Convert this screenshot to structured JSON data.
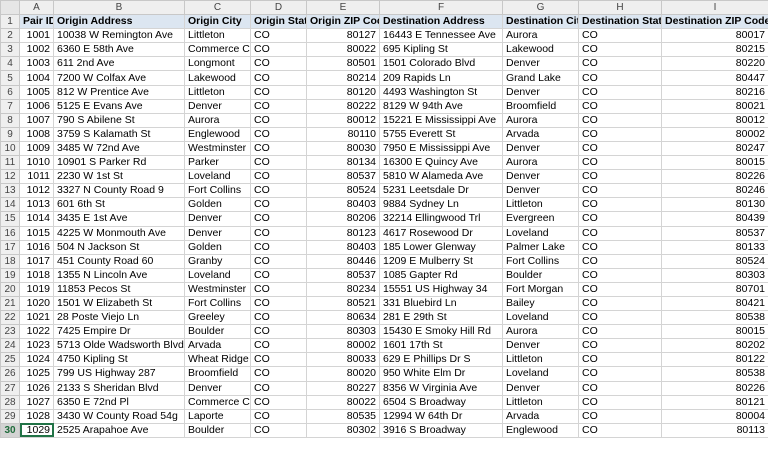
{
  "column_letters": [
    "A",
    "B",
    "C",
    "D",
    "E",
    "F",
    "G",
    "H",
    "I"
  ],
  "headers": [
    "Pair ID",
    "Origin Address",
    "Origin City",
    "Origin State",
    "Origin ZIP Code",
    "Destination Address",
    "Destination City",
    "Destination State",
    "Destination ZIP Code"
  ],
  "rows": [
    [
      "1001",
      "10038 W Remington Ave",
      "Littleton",
      "CO",
      "80127",
      "16443 E Tennessee Ave",
      "Aurora",
      "CO",
      "80017"
    ],
    [
      "1002",
      "6360 E 58th Ave",
      "Commerce Cit",
      "CO",
      "80022",
      "695 Kipling St",
      "Lakewood",
      "CO",
      "80215"
    ],
    [
      "1003",
      "611 2nd Ave",
      "Longmont",
      "CO",
      "80501",
      "1501 Colorado Blvd",
      "Denver",
      "CO",
      "80220"
    ],
    [
      "1004",
      "7200 W Colfax Ave",
      "Lakewood",
      "CO",
      "80214",
      "209 Rapids Ln",
      "Grand Lake",
      "CO",
      "80447"
    ],
    [
      "1005",
      "812 W Prentice Ave",
      "Littleton",
      "CO",
      "80120",
      "4493 Washington St",
      "Denver",
      "CO",
      "80216"
    ],
    [
      "1006",
      "5125 E Evans Ave",
      "Denver",
      "CO",
      "80222",
      "8129 W 94th Ave",
      "Broomfield",
      "CO",
      "80021"
    ],
    [
      "1007",
      "790 S Abilene St",
      "Aurora",
      "CO",
      "80012",
      "15221 E Mississippi Ave",
      "Aurora",
      "CO",
      "80012"
    ],
    [
      "1008",
      "3759 S Kalamath St",
      "Englewood",
      "CO",
      "80110",
      "5755 Everett St",
      "Arvada",
      "CO",
      "80002"
    ],
    [
      "1009",
      "3485 W 72nd Ave",
      "Westminster",
      "CO",
      "80030",
      "7950 E Mississippi Ave",
      "Denver",
      "CO",
      "80247"
    ],
    [
      "1010",
      "10901 S Parker Rd",
      "Parker",
      "CO",
      "80134",
      "16300 E Quincy Ave",
      "Aurora",
      "CO",
      "80015"
    ],
    [
      "1011",
      "2230 W 1st St",
      "Loveland",
      "CO",
      "80537",
      "5810 W Alameda Ave",
      "Denver",
      "CO",
      "80226"
    ],
    [
      "1012",
      "3327 N County Road 9",
      "Fort Collins",
      "CO",
      "80524",
      "5231 Leetsdale Dr",
      "Denver",
      "CO",
      "80246"
    ],
    [
      "1013",
      "601 6th St",
      "Golden",
      "CO",
      "80403",
      "9884 Sydney Ln",
      "Littleton",
      "CO",
      "80130"
    ],
    [
      "1014",
      "3435 E 1st Ave",
      "Denver",
      "CO",
      "80206",
      "32214 Ellingwood Trl",
      "Evergreen",
      "CO",
      "80439"
    ],
    [
      "1015",
      "4225 W Monmouth Ave",
      "Denver",
      "CO",
      "80123",
      "4617 Rosewood Dr",
      "Loveland",
      "CO",
      "80537"
    ],
    [
      "1016",
      "504 N Jackson St",
      "Golden",
      "CO",
      "80403",
      "185 Lower Glenway",
      "Palmer Lake",
      "CO",
      "80133"
    ],
    [
      "1017",
      "451 County Road 60",
      "Granby",
      "CO",
      "80446",
      "1209 E Mulberry St",
      "Fort Collins",
      "CO",
      "80524"
    ],
    [
      "1018",
      "1355 N Lincoln Ave",
      "Loveland",
      "CO",
      "80537",
      "1085 Gapter Rd",
      "Boulder",
      "CO",
      "80303"
    ],
    [
      "1019",
      "11853 Pecos St",
      "Westminster",
      "CO",
      "80234",
      "15551 US Highway 34",
      "Fort Morgan",
      "CO",
      "80701"
    ],
    [
      "1020",
      "1501 W Elizabeth St",
      "Fort Collins",
      "CO",
      "80521",
      "331 Bluebird Ln",
      "Bailey",
      "CO",
      "80421"
    ],
    [
      "1021",
      "28 Poste Viejo Ln",
      "Greeley",
      "CO",
      "80634",
      "281 E 29th St",
      "Loveland",
      "CO",
      "80538"
    ],
    [
      "1022",
      "7425 Empire Dr",
      "Boulder",
      "CO",
      "80303",
      "15430 E Smoky Hill Rd",
      "Aurora",
      "CO",
      "80015"
    ],
    [
      "1023",
      "5713 Olde Wadsworth Blvd",
      "Arvada",
      "CO",
      "80002",
      "1601 17th St",
      "Denver",
      "CO",
      "80202"
    ],
    [
      "1024",
      "4750 Kipling St",
      "Wheat Ridge",
      "CO",
      "80033",
      "629 E Phillips Dr S",
      "Littleton",
      "CO",
      "80122"
    ],
    [
      "1025",
      "799 US Highway 287",
      "Broomfield",
      "CO",
      "80020",
      "950 White Elm Dr",
      "Loveland",
      "CO",
      "80538"
    ],
    [
      "1026",
      "2133 S Sheridan Blvd",
      "Denver",
      "CO",
      "80227",
      "8356 W Virginia Ave",
      "Denver",
      "CO",
      "80226"
    ],
    [
      "1027",
      "6350 E 72nd Pl",
      "Commerce Cit",
      "CO",
      "80022",
      "6504 S Broadway",
      "Littleton",
      "CO",
      "80121"
    ],
    [
      "1028",
      "3430 W County Road 54g",
      "Laporte",
      "CO",
      "80535",
      "12994 W 64th Dr",
      "Arvada",
      "CO",
      "80004"
    ],
    [
      "1029",
      "2525 Arapahoe Ave",
      "Boulder",
      "CO",
      "80302",
      "3916 S Broadway",
      "Englewood",
      "CO",
      "80113"
    ]
  ]
}
